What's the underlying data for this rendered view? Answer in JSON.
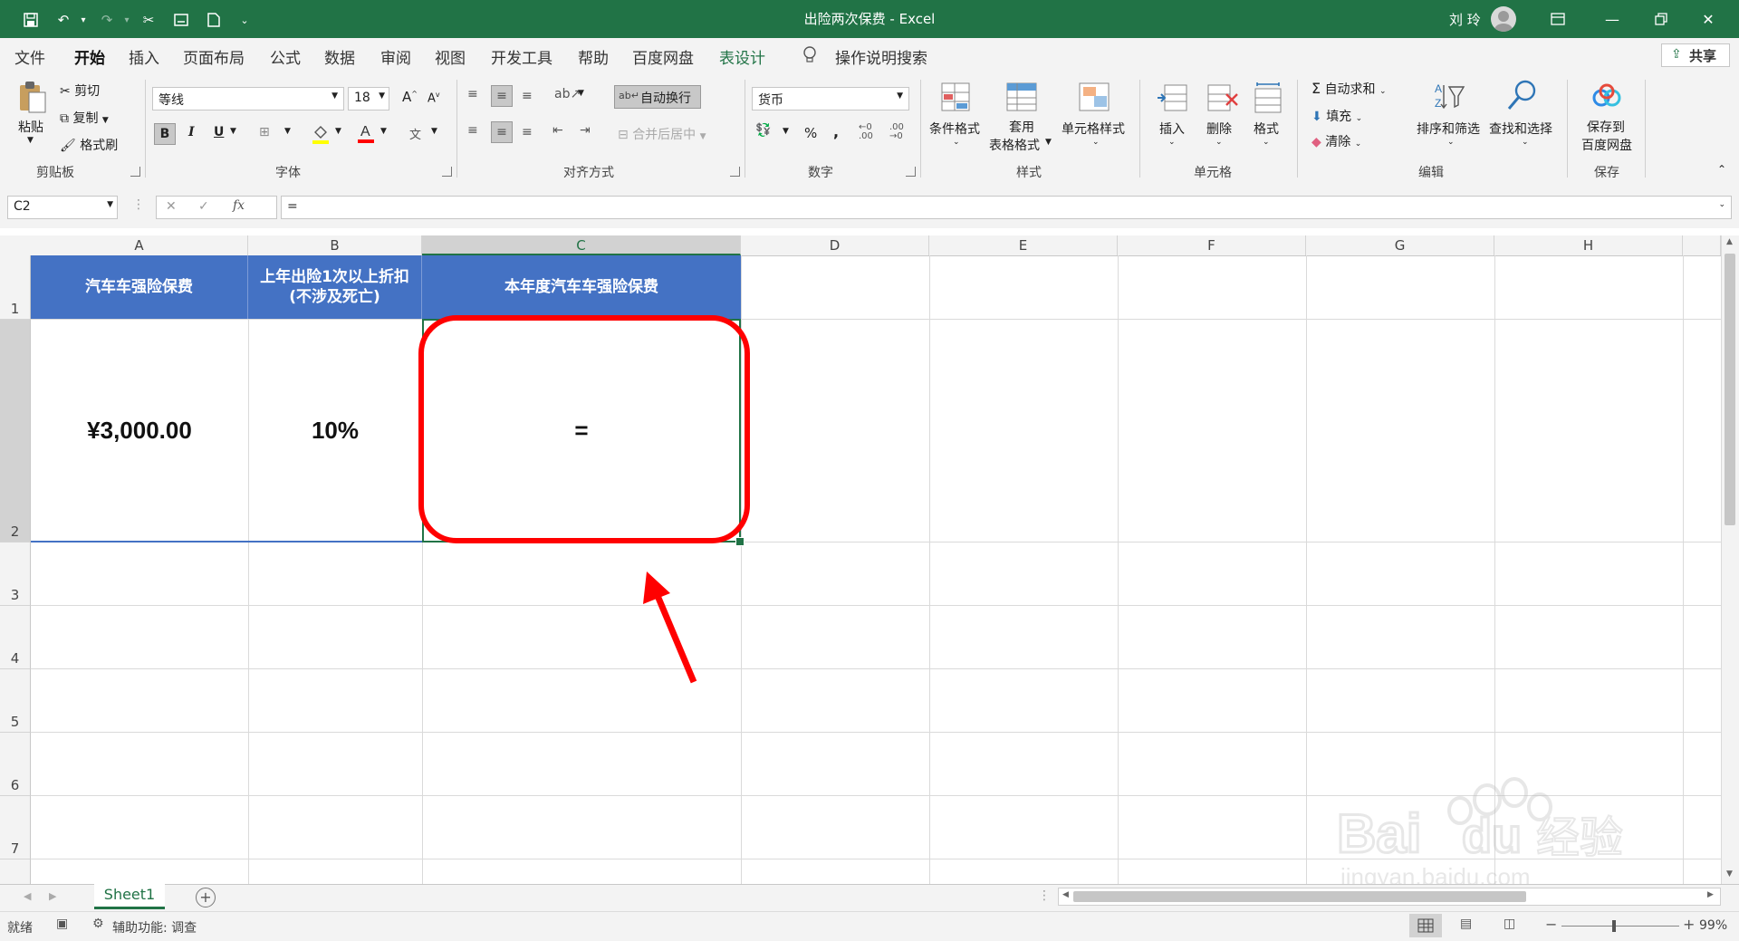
{
  "title_bar": {
    "title": "出险两次保费 - Excel",
    "user": "刘 玲"
  },
  "ribbon_tabs": [
    "文件",
    "开始",
    "插入",
    "页面布局",
    "公式",
    "数据",
    "审阅",
    "视图",
    "开发工具",
    "帮助",
    "百度网盘",
    "表设计"
  ],
  "tell_me": "操作说明搜索",
  "share": "共享",
  "clipboard": {
    "paste": "粘贴",
    "cut": "剪切",
    "copy": "复制",
    "format_painter": "格式刷",
    "label": "剪贴板"
  },
  "font": {
    "name": "等线",
    "size": "18",
    "label": "字体",
    "bold": "B",
    "italic": "I",
    "underline": "U"
  },
  "alignment": {
    "wrap": "自动换行",
    "merge": "合并后居中",
    "label": "对齐方式"
  },
  "number": {
    "format": "货币",
    "percent": "%",
    "comma": ",",
    "label": "数字"
  },
  "styles": {
    "conditional": "条件格式",
    "table_format_1": "套用",
    "table_format_2": "表格格式",
    "cell_styles": "单元格样式",
    "label": "样式"
  },
  "cells": {
    "insert": "插入",
    "delete": "删除",
    "format": "格式",
    "label": "单元格"
  },
  "editing": {
    "autosum": "自动求和",
    "fill": "填充",
    "clear": "清除",
    "sort": "排序和筛选",
    "find": "查找和选择",
    "label": "编辑"
  },
  "save_group": {
    "save_1": "保存到",
    "save_2": "百度网盘",
    "label": "保存"
  },
  "formula_bar": {
    "name_box": "C2",
    "fx": "fx",
    "formula": "="
  },
  "columns": [
    "A",
    "B",
    "C",
    "D",
    "E",
    "F",
    "G",
    "H"
  ],
  "rows": [
    "1",
    "2",
    "3",
    "4",
    "5",
    "6",
    "7"
  ],
  "header_cells": {
    "a1": "汽车车强险保费",
    "b1_line1": "上年出险1次以上折扣",
    "b1_line2": "(不涉及死亡)",
    "c1": "本年度汽车车强险保费"
  },
  "data_cells": {
    "a2": "¥3,000.00",
    "b2": "10%",
    "c2": "="
  },
  "sheet_tab": "Sheet1",
  "status": {
    "ready": "就绪",
    "accessibility": "辅助功能: 调查",
    "zoom": "99%"
  },
  "colors": {
    "excel_green": "#217346",
    "header_blue": "#4472c4",
    "annotation_red": "#ff0000"
  }
}
